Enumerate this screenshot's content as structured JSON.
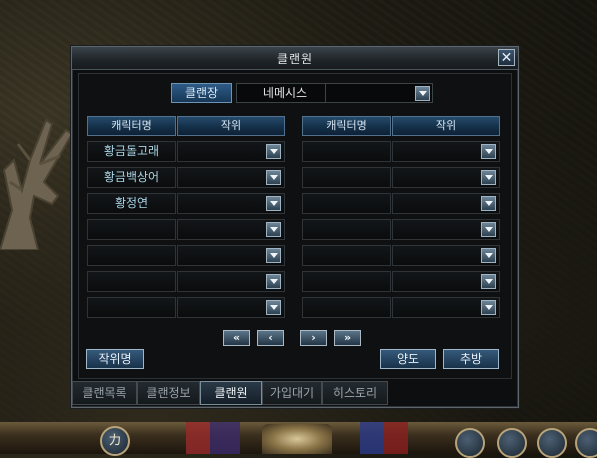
{
  "window": {
    "title": "클랜원",
    "close_glyph": "✕"
  },
  "leader": {
    "label": "클랜장",
    "name": "네메시스"
  },
  "tables": {
    "left": {
      "col_name": "캐릭터명",
      "col_rank": "작위",
      "rows": [
        "황금돌고래",
        "황금백상어",
        "황정연",
        "",
        "",
        "",
        ""
      ]
    },
    "right": {
      "col_name": "캐릭터명",
      "col_rank": "작위",
      "rows": [
        "",
        "",
        "",
        "",
        "",
        "",
        ""
      ]
    }
  },
  "pager": {
    "first": "«",
    "prev": "‹",
    "next": "›",
    "last": "»"
  },
  "buttons": {
    "rank_name": "작위명",
    "transfer": "양도",
    "expel": "추방"
  },
  "tabs": [
    "클랜목록",
    "클랜정보",
    "클랜원",
    "가입대기",
    "히스토리"
  ],
  "active_tab": "클랜원",
  "hud": {
    "left_orb": "カ"
  }
}
